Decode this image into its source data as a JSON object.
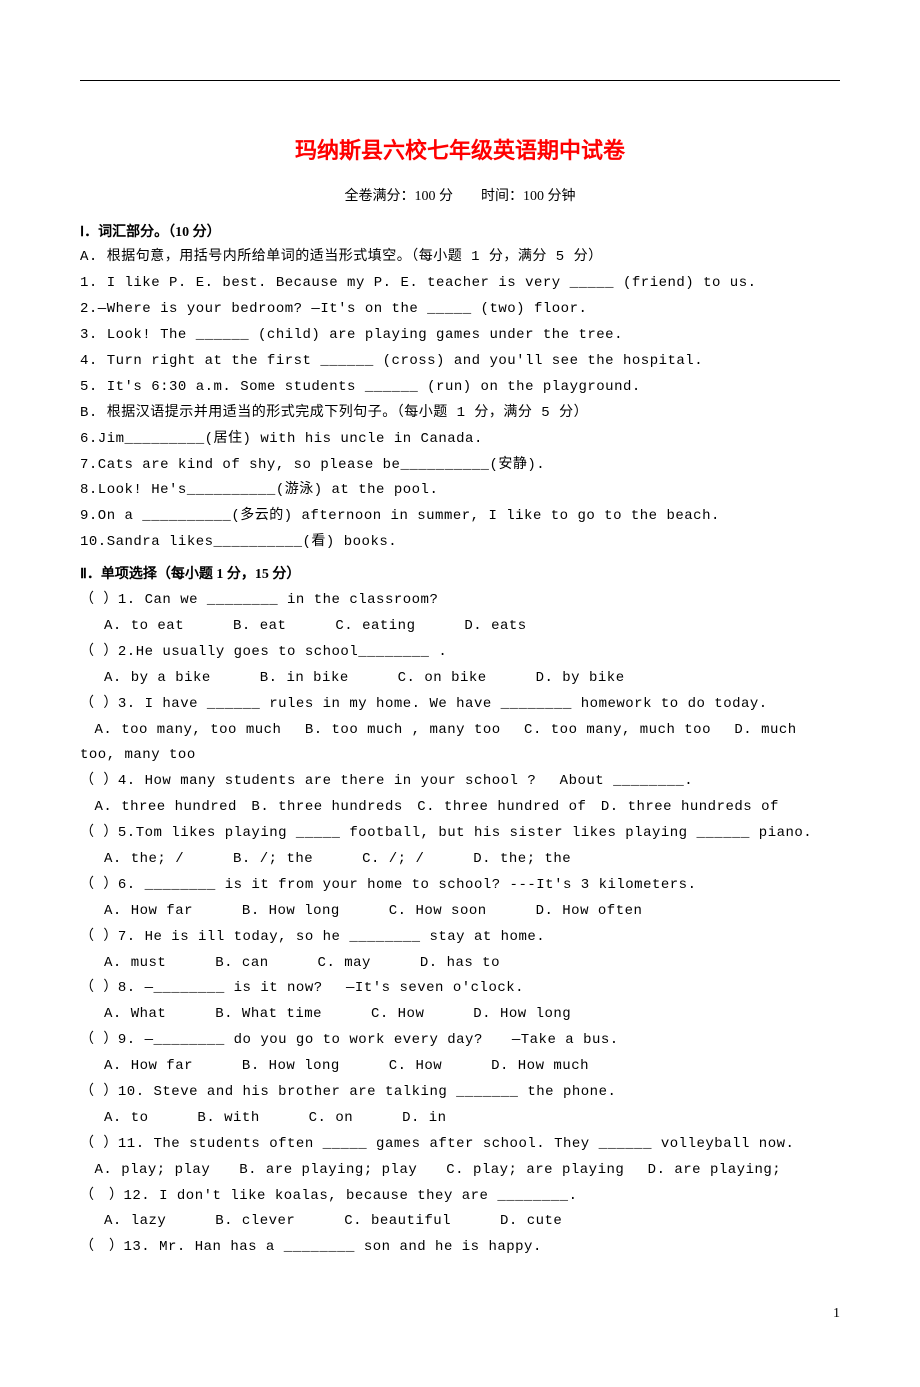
{
  "title": "玛纳斯县六校七年级英语期中试卷",
  "subtitle": "全卷满分：100 分　　时间：100 分钟",
  "section1": {
    "heading": "Ⅰ．词汇部分。（10 分）",
    "partA": "A. 根据句意，用括号内所给单词的适当形式填空。（每小题 1 分，满分 5 分）",
    "a1": "1. I like P. E. best. Because my P. E. teacher is very _____ (friend) to us.",
    "a2": "2.—Where is your bedroom? —It's on the _____ (two) floor.",
    "a3": "3. Look! The ______ (child) are playing games under the tree.",
    "a4": "4. Turn right at the first ______ (cross) and you'll see the hospital.",
    "a5": "5. It's 6:30 a.m. Some students ______ (run) on the playground.",
    "partB": "B. 根据汉语提示并用适当的形式完成下列句子。（每小题 1 分，满分 5 分）",
    "b6": "6.Jim_________(居住) with his uncle in Canada.",
    "b7": "7.Cats are kind of shy, so please be__________(安静).",
    "b8": "8.Look! He's__________(游泳) at the pool.",
    "b9": "9.On a __________(多云的) afternoon in summer, I like to go to the beach.",
    "b10": "10.Sandra likes__________(看) books."
  },
  "section2": {
    "heading": "Ⅱ．单项选择（每小题 1 分，15 分）",
    "q1": "（  ）1. Can we ________ in the classroom?",
    "q1a": "A. to eat",
    "q1b": "B. eat",
    "q1c": "C. eating",
    "q1d": "D. eats",
    "q2": "（  ）2.He usually goes to school________ .",
    "q2a": "A. by a bike",
    "q2b": "B. in bike",
    "q2c": "C. on bike",
    "q2d": "D. by bike",
    "q3": "（  ）3. I have ______ rules in my home. We have ________ homework to do today.",
    "q3line": "　A. too many, too much　 B. too much , many too　 C. too many, much too　 D. much too, many too",
    "q4": "（  ）4. How many students are there in your school ?　 About ________.",
    "q4line": "　A. three hundred　B. three hundreds　C. three hundred of　D. three hundreds of",
    "q5": "（  ）5.Tom likes playing _____ football, but his sister likes playing ______ piano.",
    "q5a": "A. the; /",
    "q5b": "B. /; the",
    "q5c": "C. /; /",
    "q5d": "D. the; the",
    "q6": "（  ）6. ________ is it from your home to school? ---It's 3 kilometers.",
    "q6a": "A. How far",
    "q6b": "B. How long",
    "q6c": "C. How soon",
    "q6d": "D. How often",
    "q7": "（  ）7. He is ill today, so he ________ stay at home.",
    "q7a": "A. must",
    "q7b": "B. can",
    "q7c": "C. may",
    "q7d": "D. has to",
    "q8": "（  ）8. —________ is it now?　 —It's seven o'clock.",
    "q8a": "A. What",
    "q8b": "B. What time",
    "q8c": "C. How",
    "q8d": "D. How long",
    "q9": "（  ）9. —________ do you go to work every day?　　—Take a bus.",
    "q9a": "A. How far",
    "q9b": "B. How long",
    "q9c": "C. How",
    "q9d": "D. How much",
    "q10": "（  ）10. Steve and his brother are talking _______ the phone.",
    "q10a": "A. to",
    "q10b": "B. with",
    "q10c": "C. on",
    "q10d": "D. in",
    "q11": "（  ）11. The students often _____ games after school. They ______ volleyball now.",
    "q11line": "　A. play; play　　B. are playing; play　　C. play; are playing　 D. are playing;",
    "q12": "（　）12. I don't like koalas, because they are ________.",
    "q12a": "A. lazy",
    "q12b": "B. clever",
    "q12c": "C. beautiful",
    "q12d": "D. cute",
    "q13": "（　）13. Mr. Han has a ________ son and he is happy."
  },
  "pageNum": "1"
}
